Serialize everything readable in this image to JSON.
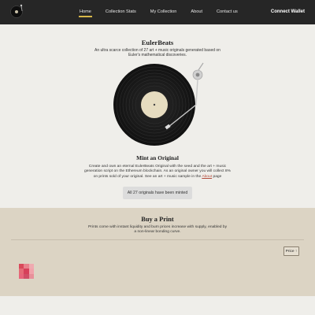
{
  "nav": {
    "links": [
      {
        "label": "Home"
      },
      {
        "label": "Collection Stats"
      },
      {
        "label": "My Collection"
      },
      {
        "label": "About"
      },
      {
        "label": "Contact us"
      }
    ],
    "connect_label": "Connect Wallet"
  },
  "hero": {
    "title": "EulerBeats",
    "subtitle": "An ultra scarce collection of 27 art + music originals generated based on Euler's mathematical discoveries."
  },
  "mint": {
    "title": "Mint an Original",
    "description": "Create and own an eternal EulerBeats Original with the seed and the art + music generation script on the Ethereum blockchain. As an original owner you will collect 8% on prints sold of your original. See an art + music sample in the",
    "link_label": "About",
    "description_end": "page",
    "status_button": "All 27 originals have been minted"
  },
  "print": {
    "title": "Buy a Print",
    "subtitle": "Prints come with instant liquidity and burn prices increase with supply, enabled by a non-linear bonding curve.",
    "price_button": "Price ↑",
    "pixel_colors": [
      "#d94a5a",
      "#e8828c",
      "#efaab0",
      "#e46a76",
      "#d7405a",
      "#f1a3ab",
      "#e8647a",
      "#d04e66",
      "#e9909a"
    ]
  },
  "colors": {
    "nav_bg": "#262626",
    "accent": "#d8b84a",
    "print_bg": "#dcd4c4",
    "link": "#b24a3a"
  }
}
